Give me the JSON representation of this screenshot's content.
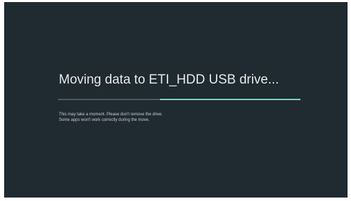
{
  "dialog": {
    "title": "Moving data to ETI_HDD USB drive...",
    "progress": {
      "start_fraction": 0.42,
      "end_fraction": 1.0,
      "track_color": "#4c5960",
      "fill_color": "#7fcfc4"
    },
    "message_line_1": "This may take a moment. Please don't remove the drive.",
    "message_line_2": "Some apps won't work correctly during the move."
  },
  "colors": {
    "background": "#1f2a31",
    "text": "#e6e9ea"
  }
}
